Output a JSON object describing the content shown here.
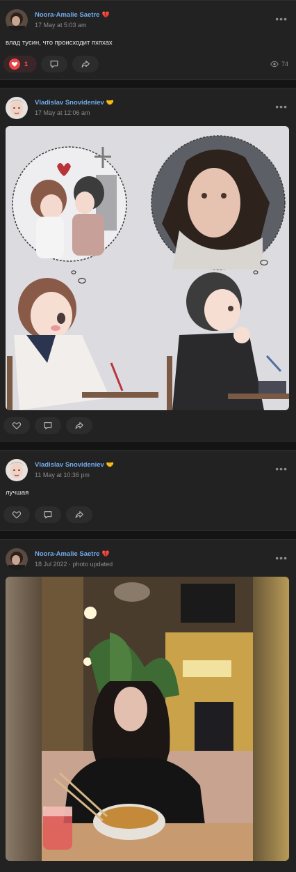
{
  "posts": [
    {
      "author": "Noora-Amalie Saetre",
      "author_emoji": "💔",
      "time": "17 May at 5:03 am",
      "text": "влад тусин, что происходит пхпхах",
      "likes": "1",
      "views": "74"
    },
    {
      "author": "Vladislav Snovideniev",
      "author_emoji": "🤝",
      "time": "17 May at 12:06 am",
      "text": ""
    },
    {
      "author": "Vladislav Snovideniev",
      "author_emoji": "🤝",
      "time": "11 May at 10:36 pm",
      "text": "лучшая"
    },
    {
      "author": "Noora-Amalie Saetre",
      "author_emoji": "💔",
      "time": "18 Jul 2022 · photo updated",
      "text": ""
    }
  ],
  "menu_glyph": "•••",
  "colors": {
    "background": "#141414",
    "card": "#222222",
    "author_link": "#71aaeb",
    "like_active": "#e64646",
    "muted_text": "#8c8c8c"
  },
  "icons": [
    "heart-icon",
    "comment-icon",
    "share-icon",
    "eye-icon",
    "more-icon"
  ]
}
